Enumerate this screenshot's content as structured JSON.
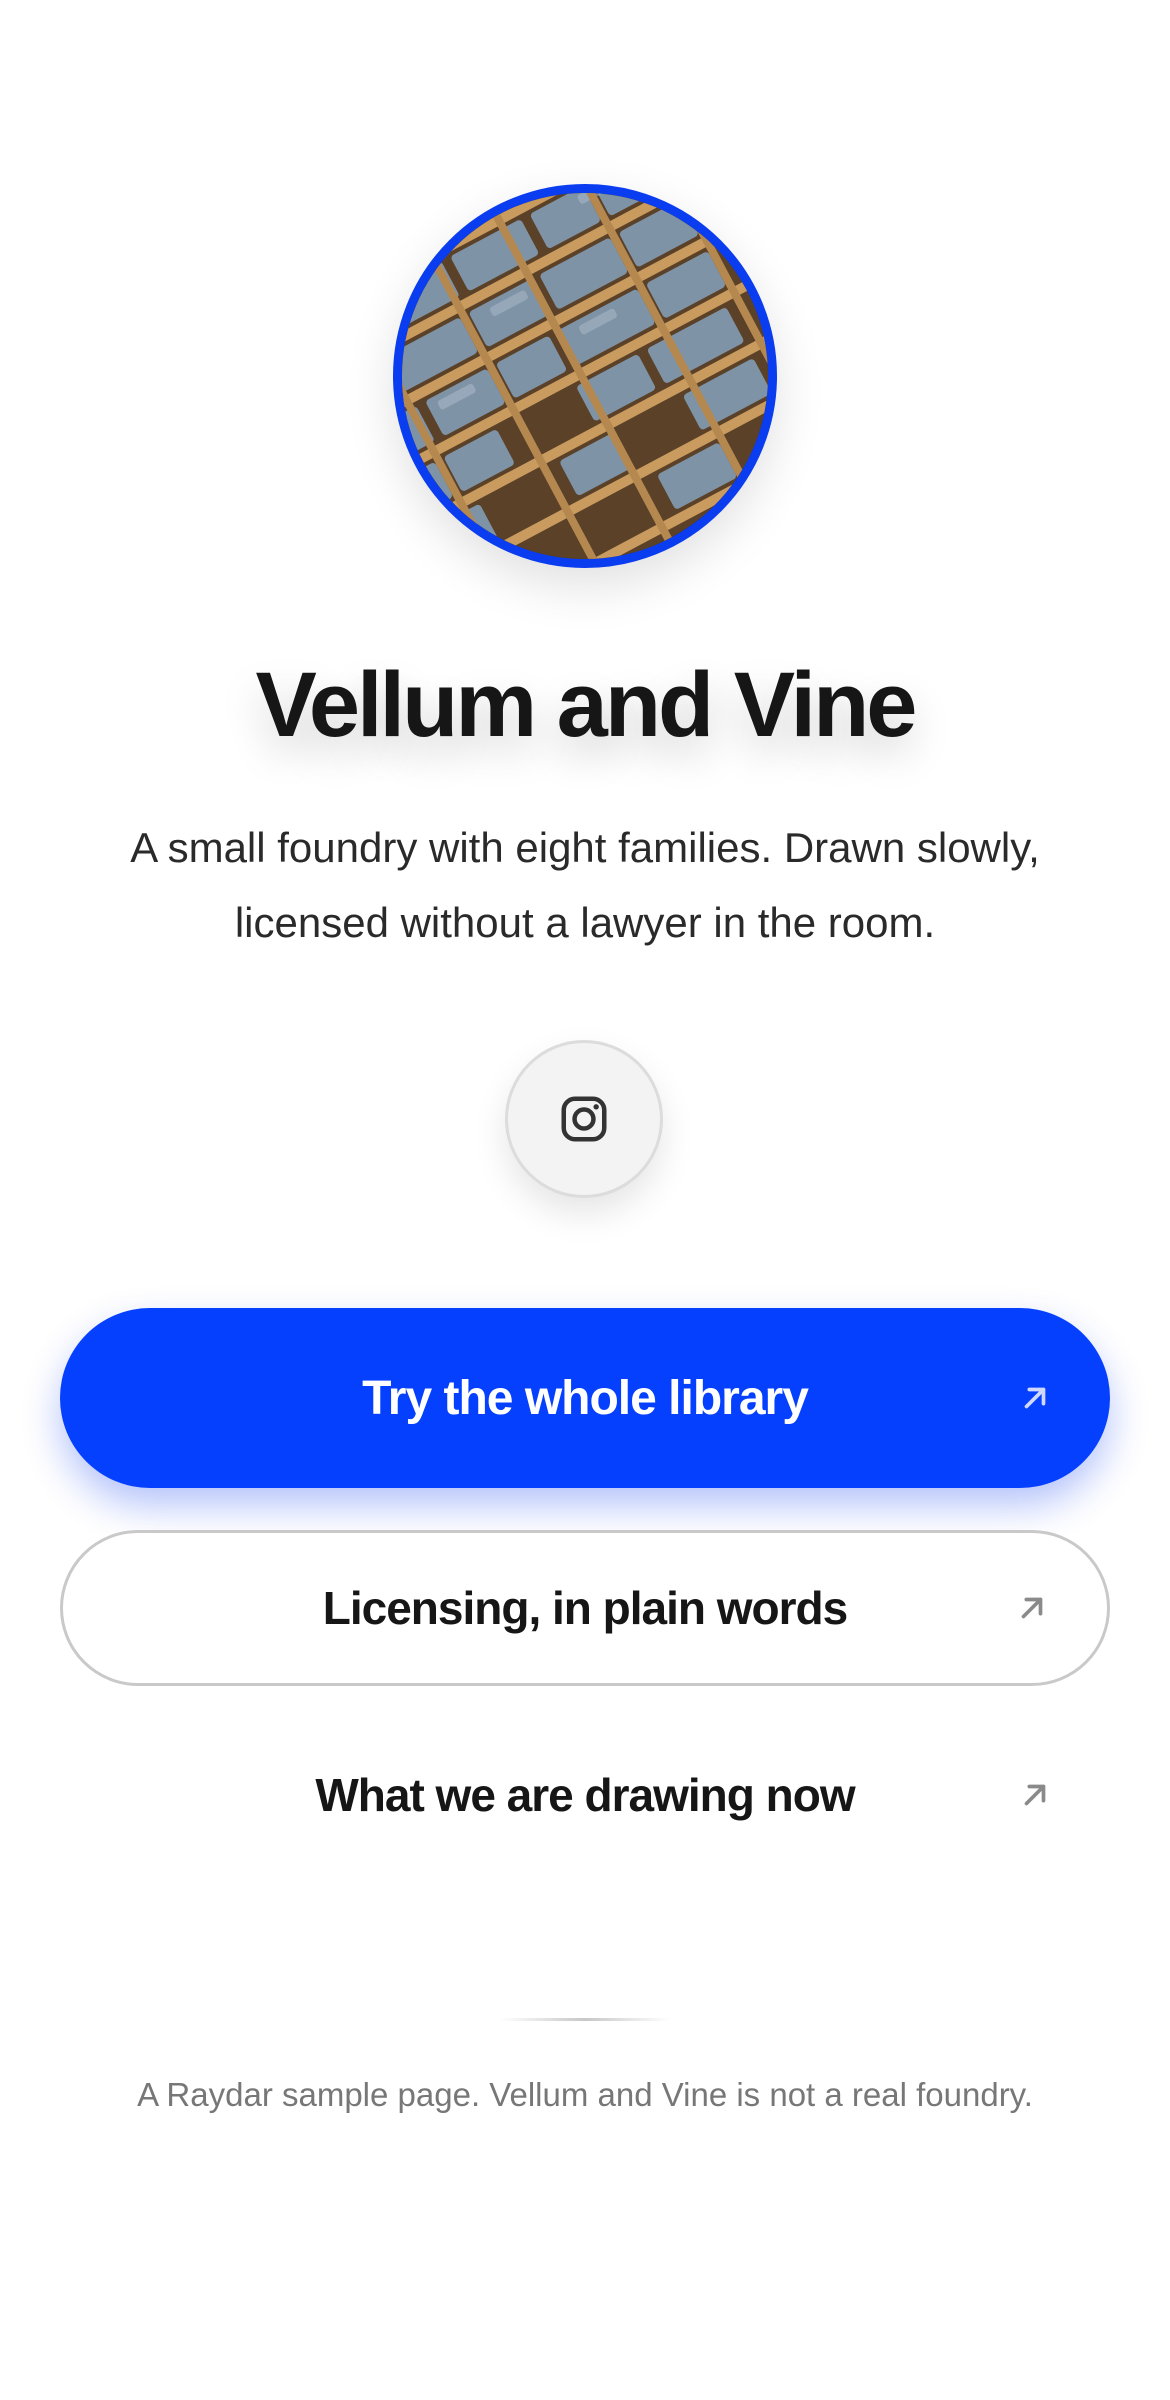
{
  "profile": {
    "avatar_icon": "letterpress-type-case-photo",
    "name": "Vellum and Vine",
    "bio": "A small foundry with eight families. Drawn slowly, licensed without a lawyer in the room."
  },
  "social": {
    "icon": "instagram-icon"
  },
  "links": [
    {
      "label": "Try the whole library",
      "style": "primary",
      "icon": "arrow-up-right-icon"
    },
    {
      "label": "Licensing, in plain words",
      "style": "outline",
      "icon": "arrow-up-right-icon"
    },
    {
      "label": "What we are drawing now",
      "style": "plain",
      "icon": "arrow-up-right-icon"
    }
  ],
  "footer": {
    "text": "A Raydar sample page. Vellum and Vine is not a real foundry."
  },
  "colors": {
    "accent": "#0640ff",
    "text": "#161616",
    "muted": "#777777",
    "outline": "#c9c9c9"
  }
}
